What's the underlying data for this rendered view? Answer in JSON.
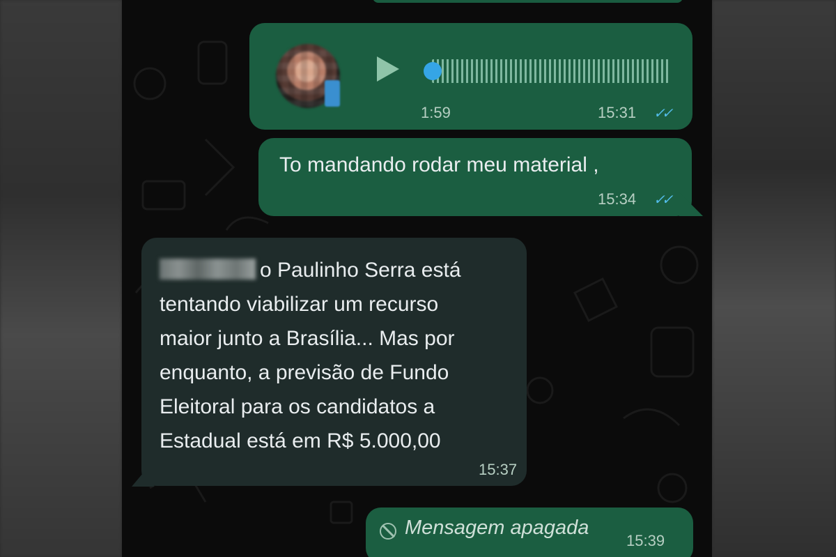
{
  "chat": {
    "voice_message": {
      "duration": "1:59",
      "time": "15:31",
      "status": "✓✓"
    },
    "outgoing_text": {
      "text": "To mandando rodar meu material ,",
      "time": "15:34",
      "status": "✓✓"
    },
    "incoming_message": {
      "lines": [
        "o Paulinho Serra está",
        "tentando viabilizar um recurso",
        "maior junto a Brasília... Mas por",
        "enquanto, a previsão de Fundo",
        "Eleitoral para os candidatos a",
        "Estadual está em R$ 5.000,00"
      ],
      "time": "15:37"
    },
    "deleted_message": {
      "text": "Mensagem apagada",
      "time": "15:39"
    }
  },
  "colors": {
    "outgoing_bubble": "#1b5e41",
    "incoming_bubble": "#1f2c2b",
    "read_ticks": "#53bdeb",
    "chat_background": "#0b0b0b"
  },
  "icons": [
    "play-icon",
    "read-receipt-icon",
    "deleted-icon",
    "mic-icon"
  ]
}
